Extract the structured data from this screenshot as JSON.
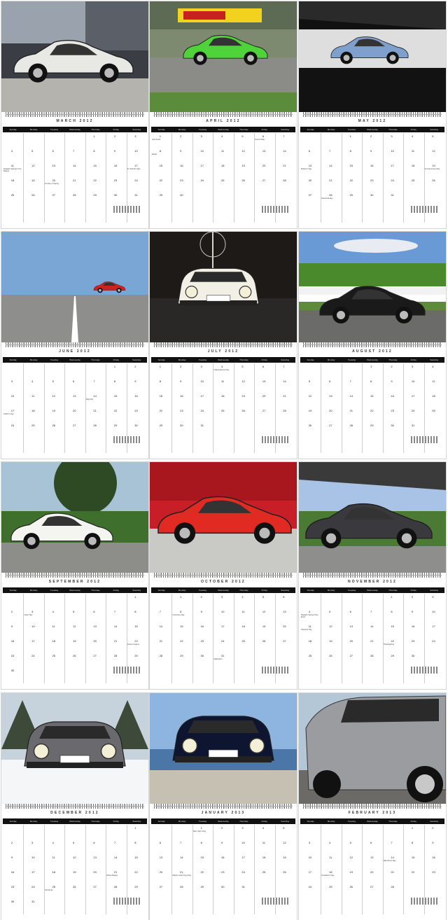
{
  "day_names": [
    "Sunday",
    "Monday",
    "Tuesday",
    "Wednesday",
    "Thursday",
    "Friday",
    "Saturday"
  ],
  "pages": [
    {
      "month": "MARCH 2012",
      "scene": "showroom",
      "car": "#e8e8e4",
      "events": [
        {
          "d": 11,
          "t": "Daylight Savings Time Begins"
        },
        {
          "d": 17,
          "t": "St. Patrick's Day"
        },
        {
          "d": 20,
          "t": "1st Day of Spring"
        }
      ]
    },
    {
      "month": "APRIL 2012",
      "scene": "track",
      "car": "#4fd33a",
      "events": [
        {
          "d": 1,
          "t": "April Fools"
        },
        {
          "d": 6,
          "t": "Good Friday"
        },
        {
          "d": 8,
          "t": "Easter"
        }
      ]
    },
    {
      "month": "MAY 2012",
      "scene": "garage",
      "car": "#7fa0cc",
      "events": [
        {
          "d": 13,
          "t": "Mother's Day"
        },
        {
          "d": 19,
          "t": "Armed Forces Day"
        },
        {
          "d": 28,
          "t": "Memorial Day"
        }
      ]
    },
    {
      "month": "JUNE 2012",
      "scene": "road",
      "car": "#cc2222",
      "events": [
        {
          "d": 14,
          "t": "Flag Day"
        },
        {
          "d": 17,
          "t": "Father's Day"
        }
      ]
    },
    {
      "month": "JULY 2012",
      "scene": "night",
      "car": "#f2f0e6",
      "events": [
        {
          "d": 4,
          "t": "Independence Day"
        }
      ]
    },
    {
      "month": "AUGUST 2012",
      "scene": "field",
      "car": "#1a1a1a",
      "events": []
    },
    {
      "month": "SEPTEMBER 2012",
      "scene": "park",
      "car": "#f4f4f0",
      "events": [
        {
          "d": 3,
          "t": "Labor Day"
        },
        {
          "d": 22,
          "t": "Autumn begins"
        }
      ]
    },
    {
      "month": "OCTOBER 2012",
      "scene": "hedge",
      "car": "#e02a22",
      "events": [
        {
          "d": 8,
          "t": "Columbus Day"
        },
        {
          "d": 31,
          "t": "Halloween"
        }
      ]
    },
    {
      "month": "NOVEMBER 2012",
      "scene": "carport",
      "car": "#3a3a3e",
      "events": [
        {
          "d": 4,
          "t": "Daylight Saving Time Ends"
        },
        {
          "d": 11,
          "t": "Veterans Day"
        },
        {
          "d": 22,
          "t": "Thanksgiving"
        }
      ]
    },
    {
      "month": "DECEMBER 2012",
      "scene": "snow",
      "car": "#6a6a6e",
      "events": [
        {
          "d": 21,
          "t": "Winter Begins"
        },
        {
          "d": 25,
          "t": "Christmas"
        }
      ]
    },
    {
      "month": "JANUARY 2013",
      "scene": "coast",
      "car": "#0d1530",
      "events": [
        {
          "d": 1,
          "t": "New Year's Day"
        },
        {
          "d": 21,
          "t": "Martin Luther King Day"
        }
      ]
    },
    {
      "month": "FEBRUARY 2013",
      "scene": "closeup",
      "car": "#9a9ca0",
      "events": [
        {
          "d": 14,
          "t": "Valentine's Day"
        },
        {
          "d": 18,
          "t": "President's Day"
        }
      ]
    }
  ]
}
